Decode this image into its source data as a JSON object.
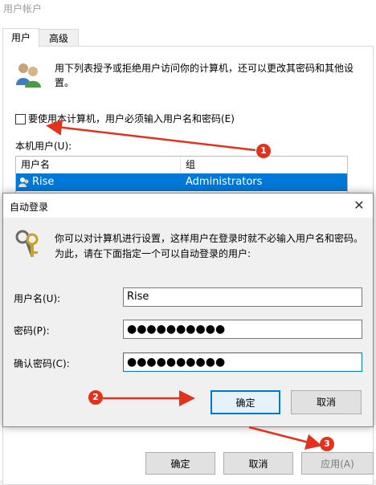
{
  "window": {
    "title": "用户帐户",
    "tabs": [
      {
        "label": "用户"
      },
      {
        "label": "高级"
      }
    ],
    "intro": "用下列表授予或拒绝用户访问你的计算机，还可以更改其密码和其他设置。",
    "must_login_label": "要使用本计算机，用户必须输入用户名和密码(E)",
    "must_login_checked": false,
    "local_users_label": "本机用户(U):",
    "table": {
      "headers": [
        "用户名",
        "组"
      ],
      "rows": [
        {
          "name": "Rise",
          "group": "Administrators"
        }
      ]
    },
    "buttons": {
      "ok": "确定",
      "cancel": "取消",
      "apply": "应用(A)"
    }
  },
  "dialog": {
    "title": "自动登录",
    "close_glyph": "✕",
    "description": "你可以对计算机进行设置，这样用户在登录时就不必输入用户名和密码。为此，请在下面指定一个可以自动登录的用户:",
    "fields": {
      "username_label": "用户名(U):",
      "username_value": "Rise",
      "password_label": "密码(P):",
      "password_value": "●●●●●●●●●●",
      "confirm_label": "确认密码(C):",
      "confirm_value": "●●●●●●●●●●"
    },
    "buttons": {
      "ok": "确定",
      "cancel": "取消"
    }
  },
  "annotations": {
    "badges": [
      "1",
      "2",
      "3"
    ],
    "color": "#e2321e"
  },
  "colors": {
    "accent": "#0078d7",
    "annotation": "#e2321e"
  }
}
